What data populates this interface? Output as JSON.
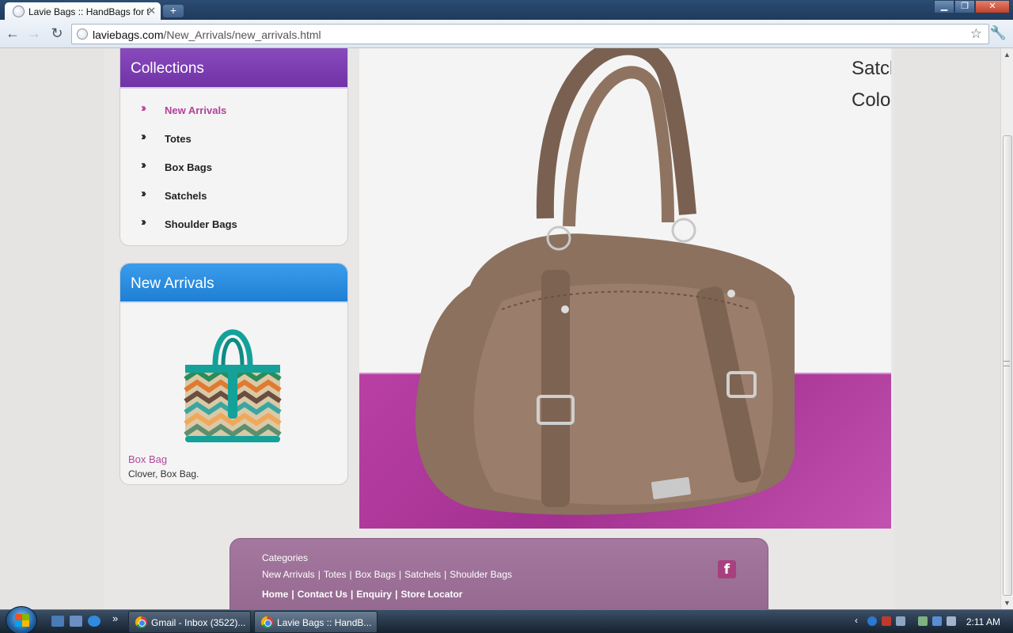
{
  "browser": {
    "tab_title": "Lavie Bags :: HandBags for t",
    "new_tab_label": "+",
    "url_host": "laviebags.com",
    "url_path": "/New_Arrivals/new_arrivals.html"
  },
  "sidebar": {
    "collections_title": "Collections",
    "items": [
      {
        "label": "New Arrivals",
        "active": true
      },
      {
        "label": "Totes"
      },
      {
        "label": "Box Bags"
      },
      {
        "label": "Satchels"
      },
      {
        "label": "Shoulder Bags"
      }
    ],
    "new_arrivals_title": "New Arrivals",
    "product": {
      "title": "Box Bag",
      "description": "Clover, Box Bag."
    }
  },
  "hero": {
    "line1": "Satcl",
    "line2": "Colo"
  },
  "footer": {
    "categories_title": "Categories",
    "category_links": [
      "New Arrivals",
      "Totes",
      "Box Bags",
      "Satchels",
      "Shoulder Bags"
    ],
    "main_links": [
      "Home",
      "Contact Us",
      "Enquiry",
      "Store Locator"
    ],
    "facebook_label": "f"
  },
  "taskbar": {
    "items": [
      {
        "label": "Gmail - Inbox (3522)..."
      },
      {
        "label": "Lavie Bags :: HandB..."
      }
    ],
    "overflow": "»",
    "clock": "2:11 AM"
  },
  "colors": {
    "collections_header": "#7033a7",
    "new_arrivals_header": "#1f7fd4",
    "active_link": "#b3409a",
    "hero_band": "#a23191",
    "footer_bg": "#9a6d95"
  }
}
